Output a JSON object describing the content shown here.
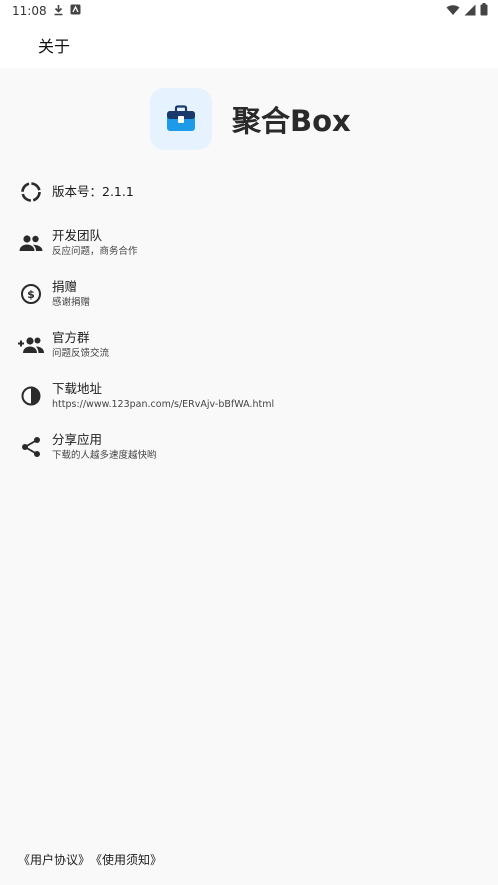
{
  "status_bar": {
    "time": "11:08"
  },
  "app_bar": {
    "title": "关于"
  },
  "hero": {
    "app_name": "聚合Box"
  },
  "items": [
    {
      "title": "版本号：2.1.1",
      "subtitle": ""
    },
    {
      "title": "开发团队",
      "subtitle": "反应问题，商务合作"
    },
    {
      "title": "捐赠",
      "subtitle": "感谢捐赠"
    },
    {
      "title": "官方群",
      "subtitle": "问题反馈交流"
    },
    {
      "title": "下载地址",
      "subtitle": "https://www.123pan.com/s/ERvAjv-bBfWA.html"
    },
    {
      "title": "分享应用",
      "subtitle": "下载的人越多速度越快哟"
    }
  ],
  "footer": {
    "user_agreement": "《用户协议》",
    "usage_notice": "《使用须知》"
  },
  "colors": {
    "icon_bg": "#e6f2fd",
    "accent": "#1e9be8"
  }
}
